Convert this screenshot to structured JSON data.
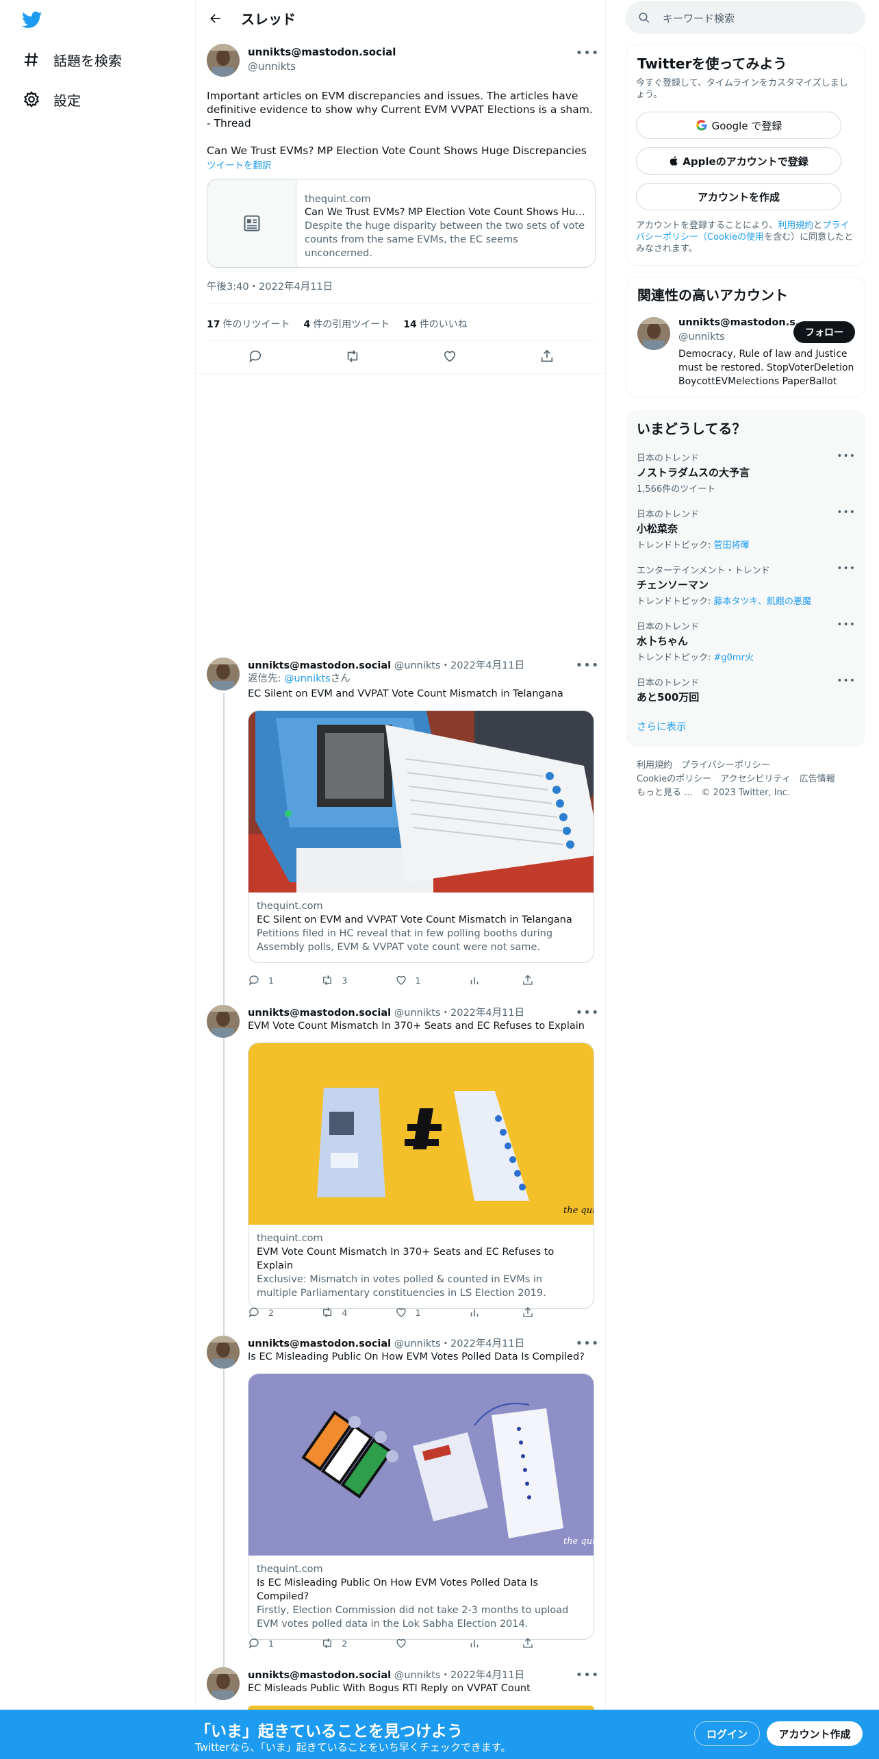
{
  "nav": {
    "explore_label": "話題を検索",
    "settings_label": "設定"
  },
  "header": {
    "title": "スレッド"
  },
  "main_tweet": {
    "display_name": "unnikts@mastodon.social",
    "handle": "@unnikts",
    "text_line1": "Important articles on EVM discrepancies and issues. The articles have",
    "text_line2": "definitive evidence to show why Current EVM VVPAT Elections is a sham.",
    "text_line3": "- Thread",
    "text_line4": "Can We Trust EVMs? MP Election Vote Count Shows Huge Discrepancies",
    "translate": "ツイートを翻訳",
    "card_domain": "thequint.com",
    "card_title": "Can We Trust EVMs? MP Election Vote Count Shows Huge...",
    "card_desc": "Despite the huge disparity between the two sets of vote counts from the same EVMs, the EC seems unconcerned.",
    "timestamp": "午後3:40・2022年4月11日",
    "retweets_count": "17",
    "retweets_label": "件のリツイート",
    "quotes_count": "4",
    "quotes_label": "件の引用ツイート",
    "likes_count": "14",
    "likes_label": "件のいいね"
  },
  "replies": [
    {
      "display_name": "unnikts@mastodon.social",
      "meta": "@unnikts・2022年4月11日",
      "reply_to_prefix": "返信先: ",
      "reply_to_handle": "@unnikts",
      "reply_to_suffix": "さん",
      "text": "EC Silent on EVM and VVPAT Vote Count Mismatch in Telangana",
      "card_domain": "thequint.com",
      "card_title": "EC Silent on EVM and VVPAT Vote Count Mismatch in Telangana",
      "card_desc": "Petitions filed in HC reveal that in few polling booths during Assembly polls, EVM & VVPAT vote count were not same.",
      "replies": "1",
      "retweets": "3",
      "likes": "1"
    },
    {
      "display_name": "unnikts@mastodon.social",
      "meta": "@unnikts・2022年4月11日",
      "text": "EVM Vote Count Mismatch In 370+ Seats and EC Refuses to Explain",
      "card_domain": "thequint.com",
      "card_title": "EVM Vote Count Mismatch In 370+ Seats and EC Refuses to Explain",
      "card_desc": "Exclusive: Mismatch in votes polled & counted in EVMs in multiple Parliamentary constituencies in LS Election 2019.",
      "replies": "2",
      "retweets": "4",
      "likes": "1"
    },
    {
      "display_name": "unnikts@mastodon.social",
      "meta": "@unnikts・2022年4月11日",
      "text": "Is EC Misleading Public On How EVM Votes Polled Data Is Compiled?",
      "card_domain": "thequint.com",
      "card_title": "Is EC Misleading Public On How EVM Votes Polled Data Is Compiled?",
      "card_desc": "Firstly, Election Commission did not take 2-3 months to upload EVM votes polled data in the Lok Sabha Election 2014.",
      "replies": "1",
      "retweets": "2",
      "likes": ""
    },
    {
      "display_name": "unnikts@mastodon.social",
      "meta": "@unnikts・2022年4月11日",
      "text": "EC Misleads Public With Bogus RTI Reply on VVPAT Count"
    }
  ],
  "search": {
    "placeholder": "キーワード検索"
  },
  "signup_box": {
    "title": "Twitterを使ってみよう",
    "subtitle": "今すぐ登録して、タイムラインをカスタマイズしましょう。",
    "google_label": "Google で登録",
    "apple_label": "Appleのアカウントで登録",
    "create_label": "アカウントを作成",
    "terms_prefix": "アカウントを登録することにより、",
    "terms_link1": "利用規約",
    "terms_mid": "と",
    "terms_link2": "プライバシーポリシー（Cookieの使用",
    "terms_suffix": "を含む）に同意したとみなされます。"
  },
  "related": {
    "title": "関連性の高いアカウント",
    "name": "unnikts@mastodon.s...",
    "handle": "@unnikts",
    "follow_label": "フォロー",
    "bio": "Democracy, Rule of law and Justice must be restored. StopVoterDeletion BoycottEVMelections PaperBallot"
  },
  "trends": {
    "title": "いまどうしてる？",
    "items": [
      {
        "category": "日本のトレンド",
        "name": "ノストラダムスの大予言",
        "context": "1,566件のツイート",
        "link": ""
      },
      {
        "category": "日本のトレンド",
        "name": "小松菜奈",
        "context": "トレンドトピック: ",
        "link": "菅田将暉"
      },
      {
        "category": "エンターテインメント・トレンド",
        "name": "チェンソーマン",
        "context": "トレンドトピック: ",
        "link": "藤本タツキ、飢餓の悪魔"
      },
      {
        "category": "日本のトレンド",
        "name": "水卜ちゃん",
        "context": "トレンドトピック: ",
        "link": "#g0mr火"
      },
      {
        "category": "日本のトレンド",
        "name": "あと500万回",
        "context": "",
        "link": ""
      }
    ],
    "show_more": "さらに表示"
  },
  "footer": {
    "terms": "利用規約",
    "privacy": "プライバシーポリシー",
    "cookie": "Cookieのポリシー",
    "accessibility": "アクセシビリティ",
    "ads": "広告情報",
    "more": "もっと見る ...",
    "copyright": "© 2023 Twitter, Inc."
  },
  "bottom_bar": {
    "title": "「いま」起きていることを見つけよう",
    "subtitle": "Twitterなら、「いま」起きていることをいち早くチェックできます。",
    "login_label": "ログイン",
    "signup_label": "アカウント作成"
  },
  "colors": {
    "accent": "#1d9bf0",
    "text": "#0f1419",
    "secondary": "#536471"
  }
}
